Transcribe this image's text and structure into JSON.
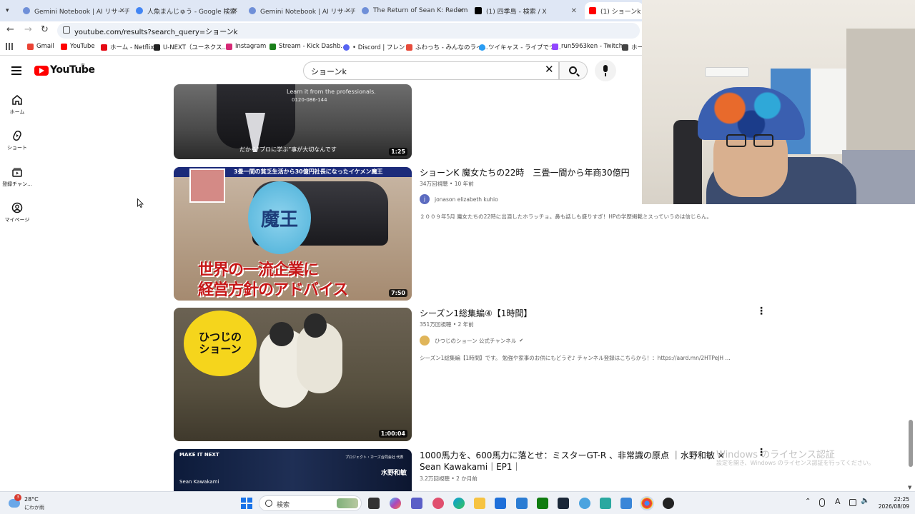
{
  "browser": {
    "tabs": [
      {
        "label": "Gemini Notebook | AI リサーチア",
        "color": "#6f8fd8"
      },
      {
        "label": "人魚まんじゅう - Google 検索",
        "color": "#4285f4"
      },
      {
        "label": "Gemini Notebook | AI リサーチア",
        "color": "#6f8fd8"
      },
      {
        "label": "The Return of Sean K: Redemp",
        "color": "#6f8fd8"
      },
      {
        "label": "(1) 四季島 - 検索 / X",
        "color": "#000000"
      },
      {
        "label": "(1) ショーンk - You",
        "color": "#ff0000"
      }
    ],
    "url": "youtube.com/results?search_query=ショーンk",
    "bookmarks": [
      {
        "label": "Gmail",
        "color": "#ea4335"
      },
      {
        "label": "YouTube",
        "color": "#ff0000"
      },
      {
        "label": "ホーム - Netflix",
        "color": "#e50914"
      },
      {
        "label": "U-NEXT（ユーネクス...",
        "color": "#222222"
      },
      {
        "label": "Instagram",
        "color": "#d62976"
      },
      {
        "label": "Stream - Kick Dashb...",
        "color": "#1a7f1a"
      },
      {
        "label": "• Discord | フレンド",
        "color": "#5865f2"
      },
      {
        "label": "ふわっち - みんなのライ...",
        "color": "#e74c3c"
      },
      {
        "label": "ツイキャス - ライブでつ...",
        "color": "#2a9df4"
      },
      {
        "label": "run5963ken - Twitch",
        "color": "#9146ff"
      },
      {
        "label": "ホー",
        "color": "#444444"
      }
    ]
  },
  "youtube": {
    "logo": "YouTube",
    "region": "JP",
    "search_query": "ショーンk",
    "nav": [
      {
        "label": "ホーム",
        "icon": "home-icon"
      },
      {
        "label": "ショート",
        "icon": "shorts-icon"
      },
      {
        "label": "登録チャン...",
        "icon": "subscriptions-icon"
      },
      {
        "label": "マイページ",
        "icon": "you-icon"
      }
    ],
    "results": [
      {
        "duration": "1:25",
        "overlay_text": "だから“プロに学ぶ”事が大切なんです",
        "overlay_ad": "Learn it from the professionals.",
        "overlay_phone": "0120-086-144"
      },
      {
        "title": "ショーンK 魔女たちの22時　三畳一間から年商30億円",
        "views": "34万回視聴",
        "age": "10 年前",
        "channel": "jonason elizabeth kuhio",
        "channel_initial": "j",
        "description": "２００９年5月 魔女たちの22時に出演したホラッチョ。鼻も話しも盛りすぎ！HPの学歴掲載ミスっていうのは信じらん。",
        "duration": "7:50",
        "thumb_top": "3畳一間の貧乏生活から30億円社長になったイケメン魔王",
        "thumb_badge": "魔王",
        "thumb_caption1": "世界の一流企業に",
        "thumb_caption2": "経営方針のアドバイス"
      },
      {
        "title": "シーズン1総集編④【1時間】",
        "views": "351万回視聴",
        "age": "2 年前",
        "channel": "ひつじのショーン 公式チャンネル",
        "verified": "✔",
        "description": "シーズン1総集編【1時間】です。 勉強や家事のお供にもどうぞ♪ チャンネル登録はこちらから！：https://aard.mn/2HTPeJH ...",
        "duration": "1:00:04",
        "thumb_text": "ひつじのショーン"
      },
      {
        "title": "1000馬力を、600馬力に落とせ：ミスターGT-R 、非常識の原点 ｜水野和敏 × Sean Kawakami｜EP1｜",
        "views": "3.2万回視聴",
        "age": "2 か月前",
        "thumb_brand": "MAKE IT NEXT",
        "thumb_guest": "Sean Kawakami",
        "thumb_host_role": "プロジェクト・カーズ合同会社 代表",
        "thumb_host": "水野和敏"
      }
    ]
  },
  "watermark": {
    "line1": "Windows のライセンス認証",
    "line2": "設定を開き、Windows のライセンス認証を行ってください。"
  },
  "taskbar": {
    "weather_badge": "3",
    "temperature": "28°C",
    "condition": "にわか雨",
    "search_placeholder": "検索",
    "time": "22:25",
    "date": "2026/08/09",
    "ime": "A"
  }
}
